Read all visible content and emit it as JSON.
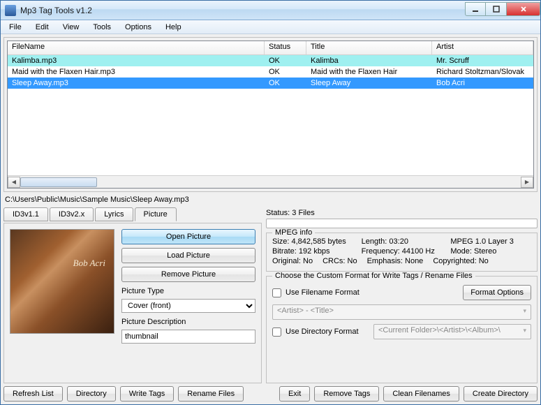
{
  "window": {
    "title": "Mp3 Tag Tools v1.2"
  },
  "menu": {
    "file": "File",
    "edit": "Edit",
    "view": "View",
    "tools": "Tools",
    "options": "Options",
    "help": "Help"
  },
  "table": {
    "headers": {
      "filename": "FileName",
      "status": "Status",
      "title": "Title",
      "artist": "Artist"
    },
    "rows": [
      {
        "file": "Kalimba.mp3",
        "status": "OK",
        "title": "Kalimba",
        "artist": "Mr. Scruff"
      },
      {
        "file": "Maid with the Flaxen Hair.mp3",
        "status": "OK",
        "title": "Maid with the Flaxen Hair",
        "artist": "Richard Stoltzman/Slovak"
      },
      {
        "file": "Sleep Away.mp3",
        "status": "OK",
        "title": "Sleep Away",
        "artist": "Bob Acri"
      }
    ]
  },
  "path": "C:\\Users\\Public\\Music\\Sample Music\\Sleep Away.mp3",
  "tabs": {
    "id3v11": "ID3v1.1",
    "id3v2x": "ID3v2.x",
    "lyrics": "Lyrics",
    "picture": "Picture"
  },
  "picture": {
    "open": "Open Picture",
    "load": "Load Picture",
    "remove": "Remove Picture",
    "type_label": "Picture Type",
    "type_value": "Cover (front)",
    "desc_label": "Picture Description",
    "desc_value": "thumbnail"
  },
  "status": {
    "label": "Status: 3 Files"
  },
  "mpeg": {
    "legend": "MPEG info",
    "size": "Size: 4,842,585 bytes",
    "length": "Length:  03:20",
    "layer": "MPEG 1.0 Layer 3",
    "bitrate": "Bitrate: 192 kbps",
    "freq": "Frequency: 44100 Hz",
    "mode": "Mode: Stereo",
    "original": "Original: No",
    "crcs": "CRCs: No",
    "emphasis": "Emphasis: None",
    "copyright": "Copyrighted: No"
  },
  "format": {
    "legend": "Choose the Custom Format for Write Tags / Rename Files",
    "use_filename": "Use Filename Format",
    "options_btn": "Format Options",
    "filename_combo": "<Artist> - <Title>",
    "use_directory": "Use Directory Format",
    "directory_combo": "<Current Folder>\\<Artist>\\<Album>\\"
  },
  "buttons": {
    "refresh": "Refresh List",
    "directory": "Directory",
    "write_tags": "Write Tags",
    "rename": "Rename Files",
    "exit": "Exit",
    "remove_tags": "Remove Tags",
    "clean": "Clean Filenames",
    "create_dir": "Create Directory"
  }
}
